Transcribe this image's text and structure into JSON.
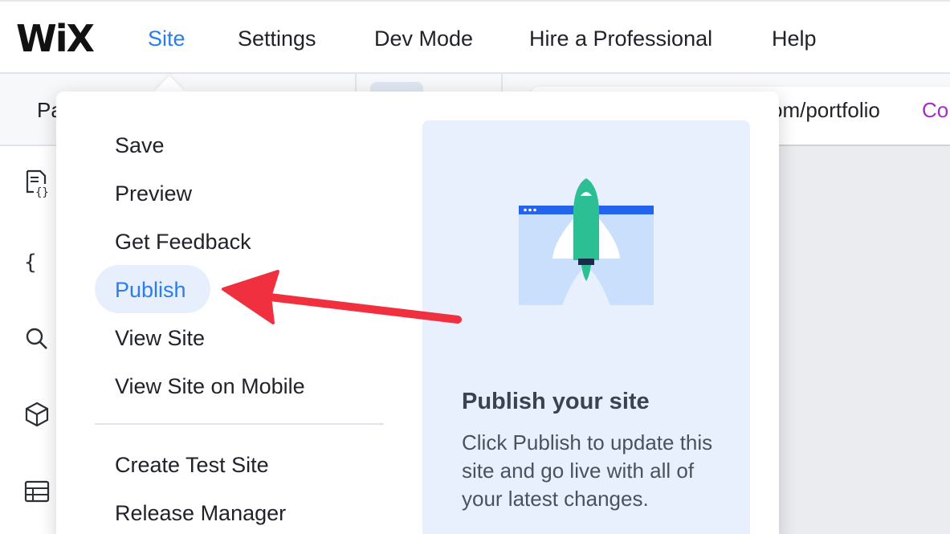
{
  "topbar": {
    "logo": "WiX",
    "nav": [
      "Site",
      "Settings",
      "Dev Mode",
      "Hire a Professional",
      "Help"
    ],
    "active": "Site"
  },
  "subbar": {
    "pages_label": "Pa",
    "url_text": "om/portfolio",
    "url_extra": "Co"
  },
  "rail": {
    "icons": [
      "page-code-icon",
      "curly-braces-icon",
      "search-icon",
      "package-icon",
      "table-icon"
    ]
  },
  "menu": {
    "items": [
      "Save",
      "Preview",
      "Get Feedback",
      "Publish",
      "View Site",
      "View Site on Mobile",
      "Create Test Site",
      "Release Manager"
    ],
    "highlighted": "Publish"
  },
  "panel": {
    "title": "Publish your site",
    "description": "Click Publish to update this site and go live with all of your latest changes."
  },
  "colors": {
    "accent": "#2b7de9",
    "highlight_bg": "#e7effd",
    "panel_bg": "#e8f0fd",
    "rocket": "#2bbf93",
    "arrow": "#f0303f"
  }
}
